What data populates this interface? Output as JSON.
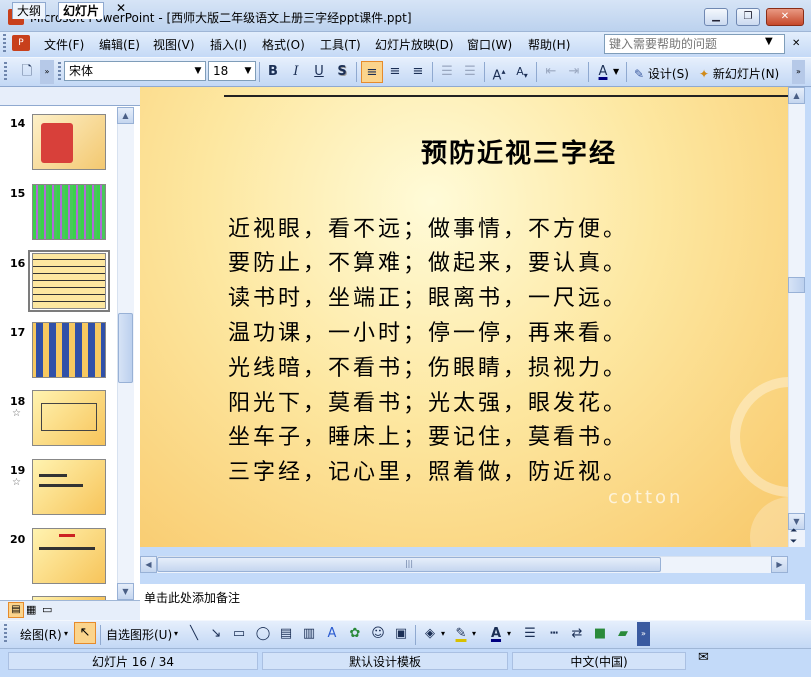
{
  "window": {
    "title": "Microsoft PowerPoint - [西师大版二年级语文上册三字经ppt课件.ppt]",
    "minimize_glyph": "▁",
    "restore_glyph": "❐",
    "close_glyph": "✕"
  },
  "menu": {
    "items": [
      "文件(F)",
      "编辑(E)",
      "视图(V)",
      "插入(I)",
      "格式(O)",
      "工具(T)",
      "幻灯片放映(D)",
      "窗口(W)",
      "帮助(H)"
    ],
    "help_placeholder": "键入需要帮助的问题"
  },
  "toolbar": {
    "font_name": "宋体",
    "font_size": "18",
    "bold": "B",
    "italic": "I",
    "underline": "U",
    "shadow": "S",
    "design_label": "设计(S)",
    "new_slide_label": "新幻灯片(N)"
  },
  "pane": {
    "tab_outline": "大纲",
    "tab_slides": "幻灯片",
    "close": "✕",
    "slides": [
      {
        "num": "14",
        "star": ""
      },
      {
        "num": "15",
        "star": ""
      },
      {
        "num": "16",
        "star": "",
        "selected": true
      },
      {
        "num": "17",
        "star": ""
      },
      {
        "num": "18",
        "star": "☆"
      },
      {
        "num": "19",
        "star": "☆"
      },
      {
        "num": "20",
        "star": ""
      }
    ]
  },
  "slide": {
    "title": "预防近视三字经",
    "lines": [
      "近视眼，看不远；做事情，不方便。",
      "要防止，不算难；做起来，要认真。",
      "读书时，坐端正；眼离书，一尺远。",
      "温功课，一小时；停一停，再来看。",
      "光线暗，不看书；伤眼睛，损视力。",
      "阳光下，莫看书；光太强，眼发花。",
      "坐车子，睡床上；要记住，莫看书。",
      "三字经，记心里，照着做，防近视。"
    ],
    "watermark": "cotton"
  },
  "notes": {
    "placeholder": "单击此处添加备注"
  },
  "drawing": {
    "draw_label": "绘图(R)",
    "autoshapes_label": "自选图形(U)"
  },
  "status": {
    "slide_counter": "幻灯片 16 / 34",
    "template": "默认设计模板",
    "language": "中文(中国)"
  }
}
